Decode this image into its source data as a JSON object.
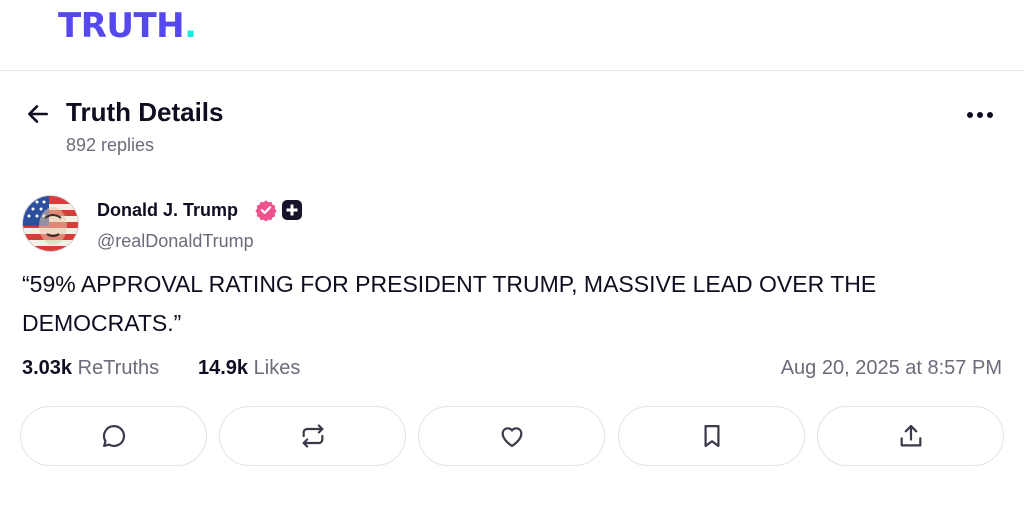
{
  "brand": {
    "logo_text": "TRUTH",
    "logo_dot": ".",
    "primary_color": "#5448ee",
    "accent_color": "#17e9e0"
  },
  "header": {
    "title": "Truth Details",
    "replies": "892 replies"
  },
  "post": {
    "author_name": "Donald J. Trump",
    "handle": "@realDonaldTrump",
    "text": "“59% APPROVAL RATING FOR PRESIDENT TRUMP, MASSIVE LEAD OVER THE DEMOCRATS.”",
    "retruths_count": "3.03k",
    "retruths_label": "ReTruths",
    "likes_count": "14.9k",
    "likes_label": "Likes",
    "timestamp": "Aug 20, 2025 at 8:57 PM",
    "verified_color": "#f0508c"
  },
  "actions": [
    "reply-icon",
    "retruth-icon",
    "like-icon",
    "bookmark-icon",
    "share-icon"
  ]
}
